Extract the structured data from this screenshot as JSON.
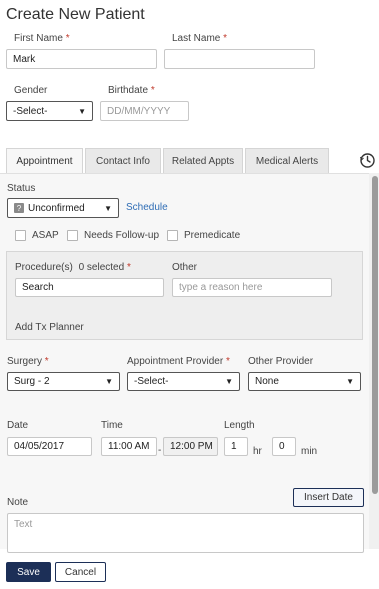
{
  "page": {
    "title": "Create New Patient"
  },
  "patient": {
    "first_name_label": "First Name",
    "first_name_value": "Mark",
    "last_name_label": "Last Name",
    "last_name_value": "",
    "required_mark": "*",
    "gender_label": "Gender",
    "gender_value": "-Select-",
    "birthdate_label": "Birthdate",
    "birthdate_placeholder": "DD/MM/YYYY"
  },
  "tabs": [
    {
      "label": "Appointment",
      "active": true
    },
    {
      "label": "Contact Info",
      "active": false
    },
    {
      "label": "Related Appts",
      "active": false
    },
    {
      "label": "Medical Alerts",
      "active": false
    }
  ],
  "history_icon": "clock-history-icon",
  "appointment": {
    "status_label": "Status",
    "status_value": "Unconfirmed",
    "status_icon_glyph": "?",
    "schedule_link": "Schedule",
    "checkboxes": [
      {
        "label": "ASAP",
        "checked": false
      },
      {
        "label": "Needs Follow-up",
        "checked": false
      },
      {
        "label": "Premedicate",
        "checked": false
      }
    ],
    "procedures_label": "Procedure(s)",
    "procedures_count": "0 selected",
    "procedures_search": "Search",
    "other_label": "Other",
    "other_placeholder": "type a reason here",
    "add_tx_planner": "Add Tx Planner",
    "surgery_label": "Surgery",
    "surgery_value": "Surg - 2",
    "provider_label": "Appointment Provider",
    "provider_value": "-Select-",
    "other_provider_label": "Other Provider",
    "other_provider_value": "None",
    "date_label": "Date",
    "date_value": "04/05/2017",
    "time_label": "Time",
    "time_start": "11:00 AM",
    "time_sep": "-",
    "time_end": "12:00 PM",
    "length_label": "Length",
    "length_hr": "1",
    "hr_unit": "hr",
    "length_min": "0",
    "min_unit": "min",
    "note_label": "Note",
    "insert_date_button": "Insert Date",
    "note_placeholder": "Text"
  },
  "footer": {
    "save": "Save",
    "cancel": "Cancel"
  },
  "colors": {
    "primary": "#1c2f57",
    "link": "#2f6db5",
    "required": "#c0392b",
    "panel_bg": "#f7f7f7"
  }
}
